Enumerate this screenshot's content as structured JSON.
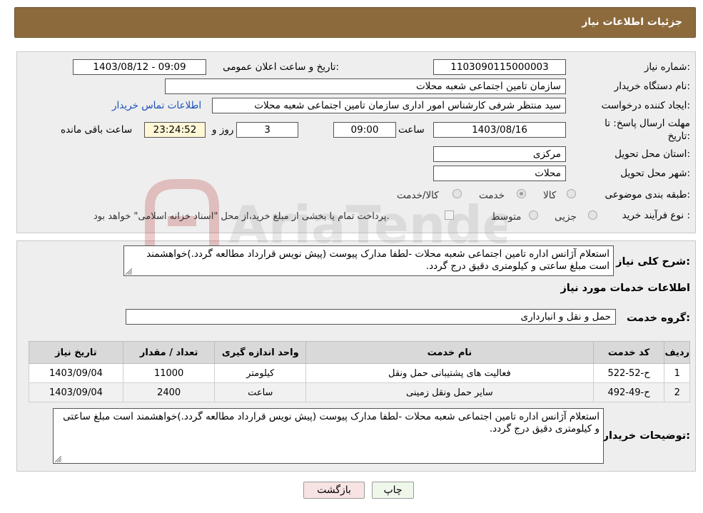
{
  "header": {
    "title": "جزئیات اطلاعات نیاز"
  },
  "info": {
    "need_number_label": "شماره نیاز:",
    "need_number": "1103090115000003",
    "announce_label": "تاریخ و ساعت اعلان عمومی:",
    "announce_value": "1403/08/12 - 09:09",
    "buyer_label": "نام دستگاه خریدار:",
    "buyer_value": "سازمان تامین اجتماعی شعبه محلات",
    "creator_label": "ایجاد کننده درخواست:",
    "creator_value": "سید منتظر شرفی کارشناس امور اداری سازمان تامین اجتماعی شعبه محلات",
    "contact_link": "اطلاعات تماس خریدار",
    "deadline_label_1": "مهلت ارسال پاسخ: تا",
    "deadline_label_2": "تاریخ:",
    "deadline_date": "1403/08/16",
    "time_label": "ساعت",
    "deadline_time": "09:00",
    "days_value": "3",
    "days_label": "روز و",
    "remaining_time": "23:24:52",
    "remaining_label": "ساعت باقی مانده",
    "province_label": "استان محل تحویل:",
    "province_value": "مرکزی",
    "city_label": "شهر محل تحویل:",
    "city_value": "محلات",
    "category_label": "طبقه بندی موضوعی:",
    "category_options": [
      "کالا",
      "خدمت",
      "کالا/خدمت"
    ],
    "category_selected": "خدمت",
    "process_label": "نوع فرآیند خرید :",
    "process_options": [
      "جزیی",
      "متوسط"
    ],
    "payment_note": "پرداخت تمام یا بخشی از مبلغ خرید،از محل \"اسناد خزانه اسلامی\" خواهد بود."
  },
  "description": {
    "label": "شرح کلی نیاز:",
    "text": "استعلام آژانس اداره تامین اجتماعی شعبه محلات -لطفا مدارک پیوست (پیش نویس قرارداد مطالعه گردد.)خواهشمند است مبلغ ساعتی و کیلومتری دقیق درج گردد."
  },
  "services": {
    "section_title": "اطلاعات خدمات مورد نیاز",
    "group_label": "گروه خدمت:",
    "group_value": "حمل و نقل و انبارداری",
    "columns": [
      "ردیف",
      "کد خدمت",
      "نام خدمت",
      "واحد اندازه گیری",
      "تعداد / مقدار",
      "تاریخ نیاز"
    ],
    "rows": [
      [
        "1",
        "ح-52-522",
        "فعالیت های پشتیبانی حمل ونقل",
        "کیلومتر",
        "11000",
        "1403/09/04"
      ],
      [
        "2",
        "ح-49-492",
        "سایر حمل ونقل زمینی",
        "ساعت",
        "2400",
        "1403/09/04"
      ]
    ]
  },
  "buyer_notes": {
    "label": "توضیحات خریدار:",
    "text": "استعلام آژانس اداره تامین اجتماعی شعبه محلات -لطفا مدارک پیوست (پیش نویس قرارداد مطالعه گردد.)خواهشمند است مبلغ ساعتی و کیلومتری دقیق درج گردد."
  },
  "buttons": {
    "print": "چاپ",
    "back": "بازگشت"
  },
  "watermark": {
    "text": "AriaTender.neT"
  },
  "colors": {
    "header_bg": "#8c6a3c",
    "panel_bg": "#eeeeee",
    "link": "#1a4fb8"
  }
}
